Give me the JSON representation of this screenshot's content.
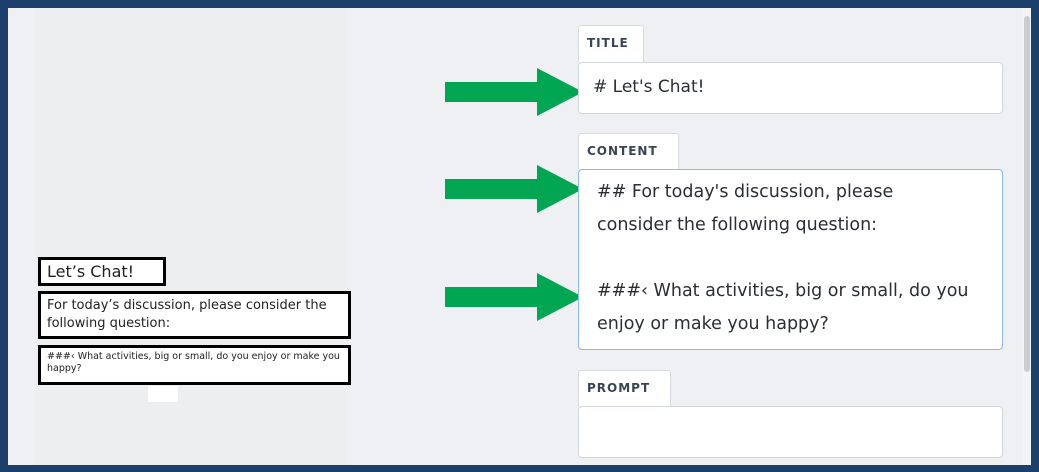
{
  "preview": {
    "title": "Let’s Chat!",
    "content": "For today’s discussion, please consider the following question:",
    "h3_line": "###‹ What activities, big or small, do you enjoy or make you happy?"
  },
  "form": {
    "title_label": "TITLE",
    "title_value": "# Let's Chat!",
    "content_label": "CONTENT",
    "content_value": "## For today's discussion, please\nconsider the following question:\n\n###‹ What activities, big or small, do you\nenjoy or make you happy?",
    "prompt_label": "PROMPT",
    "prompt_value": ""
  },
  "colors": {
    "frame_border": "#1d3f6b",
    "arrow": "#00a651",
    "focus_border": "#8cb9e6"
  },
  "icons": [
    "right-arrow-icon",
    "right-arrow-icon",
    "right-arrow-icon"
  ]
}
